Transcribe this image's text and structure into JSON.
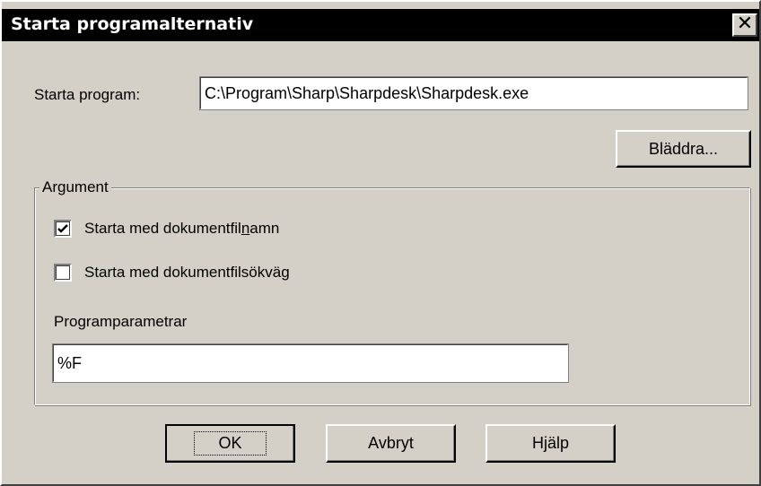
{
  "window": {
    "title": "Starta programalternativ",
    "close_glyph": "✕"
  },
  "program": {
    "label": "Starta program:",
    "value": "C:\\Program\\Sharp\\Sharpdesk\\Sharpdesk.exe"
  },
  "browse_button": {
    "label": "Bläddra..."
  },
  "argument_group": {
    "label": "Argument",
    "checkbox_filename": {
      "label_before": "Starta med dokumentfil",
      "label_accel": "n",
      "label_after": "amn",
      "checked": true
    },
    "checkbox_filepath": {
      "label": "Starta med dokumentfilsökväg",
      "checked": false
    },
    "params_label": "Programparametrar",
    "params_value": "%F"
  },
  "buttons": {
    "ok": "OK",
    "cancel": "Avbryt",
    "help": "Hjälp"
  },
  "icons": {
    "close": "close-icon",
    "check": "checkmark-icon"
  },
  "colors": {
    "face": "#d4d0c8",
    "titlebar": "#000000",
    "title_text": "#ffffff",
    "field_bg": "#ffffff"
  }
}
